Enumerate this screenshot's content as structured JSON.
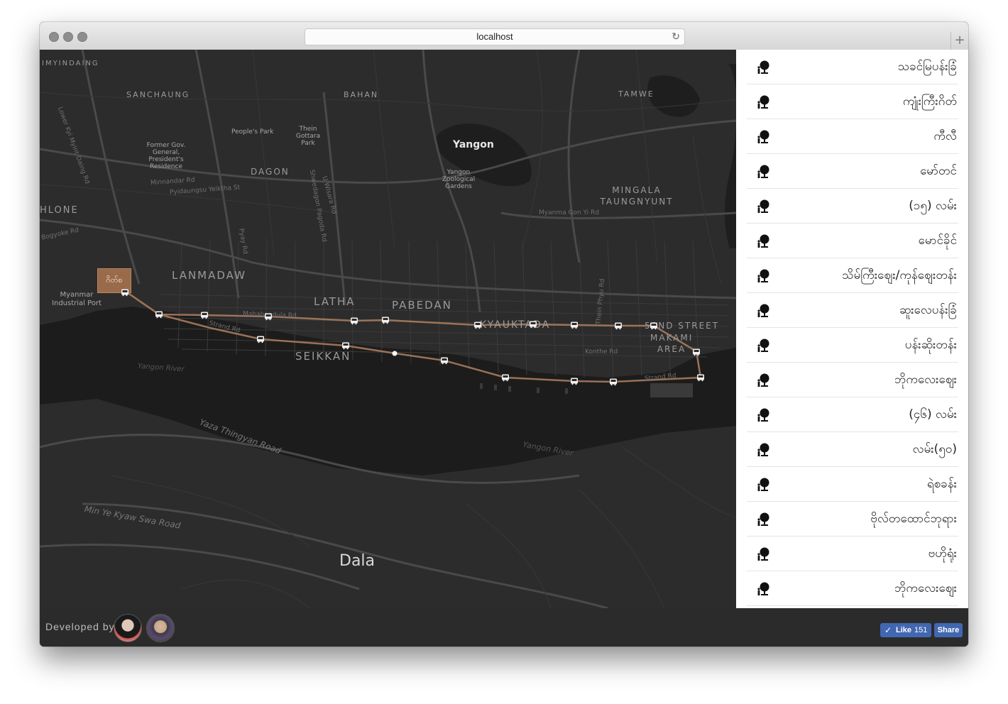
{
  "browser": {
    "url": "localhost",
    "reload_icon": "↻",
    "new_tab_icon": "+"
  },
  "map": {
    "labels": {
      "imyindaing": "IMYINDAING",
      "sanchaung": "SANCHAUNG",
      "bahan": "BAHAN",
      "tamwe": "TAMWE",
      "peoples_park": "People's Park",
      "thein_gottara": "Thein Gottara Park",
      "yangon": "Yangon",
      "former_gov": "Former Gov. General, President's Residence",
      "dagon": "DAGON",
      "yangon_zoo": "Yangon Zoological Gardens",
      "mingala": "MINGALA TAUNGNYUNT",
      "hlone": "HLONE",
      "lanmadaw": "LANMADAW",
      "latha": "LATHA",
      "pabedan": "PABEDAN",
      "kyauktada": "KYAUKTADA",
      "botataung_street": "52ND STREET",
      "makami_area": "MAKAMI AREA",
      "myanmar_port": "Myanmar Industrial Port",
      "seikkan": "SEIKKAN",
      "yangon_river_1": "Yangon River",
      "yangon_river_2": "Yangon River",
      "yaza_road": "Yaza Thingyan Road",
      "min_ye_road": "Min Ye Kyaw Swa Road",
      "dala": "Dala",
      "mahabandula_rd": "Mahabandula Rd",
      "strand_rd_1": "Strand Rd",
      "strand_rd_2": "Strand Rd",
      "konthe_rd": "Konthe Rd",
      "thein_phyu_rd": "Thein Phyu Rd",
      "pyay_rd": "Pyay Rd",
      "u_wisara": "U Wisara Rd",
      "myanma_gon_yi": "Myanma Gon Yi Rd",
      "shwedagon_pagoda_rd": "Shwedagon Pagoda Rd",
      "lower_kyi_myint": "Lower Kyi Myint Daing Rd",
      "minnandar": "Minnandar Rd",
      "pyidaungsu": "Pyidaungsu Yeiktha St",
      "bogyoke_rd": "Bogyoke Rd"
    },
    "marker_label": "ဂိတ်စ",
    "accent_color": "#9a6b4a",
    "route_color": "#b08060"
  },
  "stops": [
    {
      "name": "သခင်မြပန်းခြံ",
      "icon": "bus-stop-pin-icon"
    },
    {
      "name": "ကျုံးကြီးဂိတ်",
      "icon": "bus-stop-pin-icon"
    },
    {
      "name": "ကီလီ",
      "icon": "bus-stop-pin-icon"
    },
    {
      "name": "မော်တင်",
      "icon": "bus-stop-pin-icon"
    },
    {
      "name": "(၁၅) လမ်း",
      "icon": "bus-stop-pin-icon"
    },
    {
      "name": "မောင်ခိုင်",
      "icon": "bus-stop-pin-icon"
    },
    {
      "name": "သိမ်ကြီးဈေး/ကုန်ဈေးတန်း",
      "icon": "bus-stop-pin-icon"
    },
    {
      "name": "ဆူးလေပန်းခြံ",
      "icon": "bus-stop-pin-icon"
    },
    {
      "name": "ပန်းဆိုးတန်း",
      "icon": "bus-stop-pin-icon"
    },
    {
      "name": "ဘိုကလေးဈေး",
      "icon": "bus-stop-pin-icon"
    },
    {
      "name": "(၄၆) လမ်း",
      "icon": "bus-stop-pin-icon"
    },
    {
      "name": "လမ်း(၅၀)",
      "icon": "bus-stop-pin-icon"
    },
    {
      "name": "ရဲစခန်း",
      "icon": "bus-stop-pin-icon"
    },
    {
      "name": "ဗိုလ်တထောင်ဘုရား",
      "icon": "bus-stop-pin-icon"
    },
    {
      "name": "ဗဟိုရုံး",
      "icon": "bus-stop-pin-icon"
    },
    {
      "name": "ဘိုကလေးဈေး",
      "icon": "bus-stop-pin-icon"
    }
  ],
  "footer": {
    "developed_by": "Developed by",
    "like_label": "Like",
    "like_count": "151",
    "share_label": "Share"
  }
}
